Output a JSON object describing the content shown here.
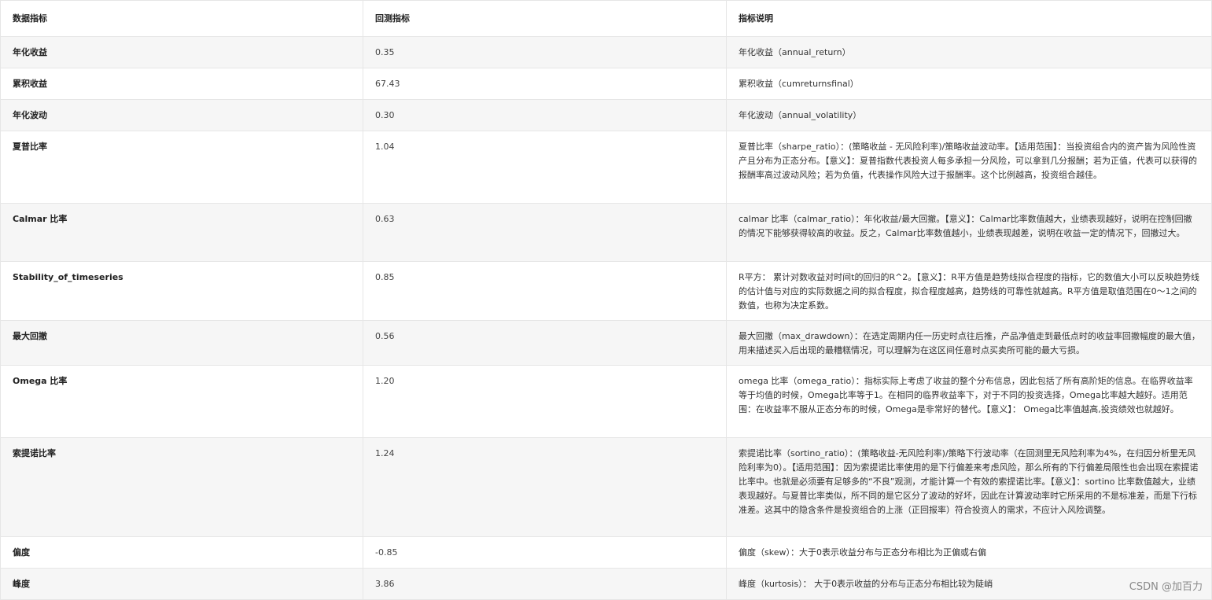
{
  "table": {
    "headers": [
      "数据指标",
      "回测指标",
      "指标说明"
    ],
    "rows": [
      {
        "name": "年化收益",
        "value": "0.35",
        "desc": "年化收益（annual_return）"
      },
      {
        "name": "累积收益",
        "value": "67.43",
        "desc": "累积收益（cumreturnsfinal）"
      },
      {
        "name": "年化波动",
        "value": "0.30",
        "desc": "年化波动（annual_volatility）"
      },
      {
        "name": "夏普比率",
        "value": "1.04",
        "desc": "夏普比率（sharpe_ratio）：(策略收益 - 无风险利率)/策略收益波动率。【适用范围】：当投资组合内的资产皆为风险性资产且分布为正态分布。【意义】：夏普指数代表投资人每多承担一分风险，可以拿到几分报酬；若为正值，代表可以获得的报酬率高过波动风险；若为负值，代表操作风险大过于报酬率。这个比例越高，投资组合越佳。"
      },
      {
        "name": "Calmar 比率",
        "value": "0.63",
        "desc": "calmar 比率（calmar_ratio）：年化收益/最大回撤。【意义】：Calmar比率数值越大，业绩表现越好，说明在控制回撤的情况下能够获得较高的收益。反之，Calmar比率数值越小，业绩表现越差，说明在收益一定的情况下，回撤过大。"
      },
      {
        "name": "Stability_of_timeseries",
        "value": "0.85",
        "desc": "R平方： 累计对数收益对时间t的回归的R^2。【意义】：R平方值是趋势线拟合程度的指标，它的数值大小可以反映趋势线的估计值与对应的实际数据之间的拟合程度，拟合程度越高，趋势线的可靠性就越高。R平方值是取值范围在0～1之间的数值，也称为决定系数。"
      },
      {
        "name": "最大回撤",
        "value": "0.56",
        "desc": "最大回撤（max_drawdown）：在选定周期内任一历史时点往后推，产品净值走到最低点时的收益率回撤幅度的最大值，用来描述买入后出现的最糟糕情况，可以理解为在这区间任意时点买卖所可能的最大亏损。"
      },
      {
        "name": "Omega 比率",
        "value": "1.20",
        "desc": "omega 比率（omega_ratio）：指标实际上考虑了收益的整个分布信息，因此包括了所有高阶矩的信息。在临界收益率等于均值的时候，Omega比率等于1。在相同的临界收益率下，对于不同的投资选择，Omega比率越大越好。适用范围：在收益率不服从正态分布的时候，Omega是非常好的替代。【意义】： Omega比率值越高,投资绩效也就越好。"
      },
      {
        "name": "索提诺比率",
        "value": "1.24",
        "desc": "索提诺比率（sortino_ratio）：(策略收益-无风险利率)/策略下行波动率（在回测里无风险利率为4%，在归因分析里无风险利率为0）。【适用范围】：因为索提诺比率使用的是下行偏差来考虑风险，那么所有的下行偏差局限性也会出现在索提诺比率中。也就是必须要有足够多的“不良”观测，才能计算一个有效的索提诺比率。【意义】：sortino 比率数值越大，业绩表现越好。与夏普比率类似，所不同的是它区分了波动的好坏，因此在计算波动率时它所采用的不是标准差，而是下行标准差。这其中的隐含条件是投资组合的上涨（正回报率）符合投资人的需求，不应计入风险调整。"
      },
      {
        "name": "偏度",
        "value": "-0.85",
        "desc": "偏度（skew）：大于0表示收益分布与正态分布相比为正偏或右偏"
      },
      {
        "name": "峰度",
        "value": "3.86",
        "desc": "峰度（kurtosis）： 大于0表示收益的分布与正态分布相比较为陡峭"
      }
    ]
  },
  "watermark": "CSDN @加百力"
}
